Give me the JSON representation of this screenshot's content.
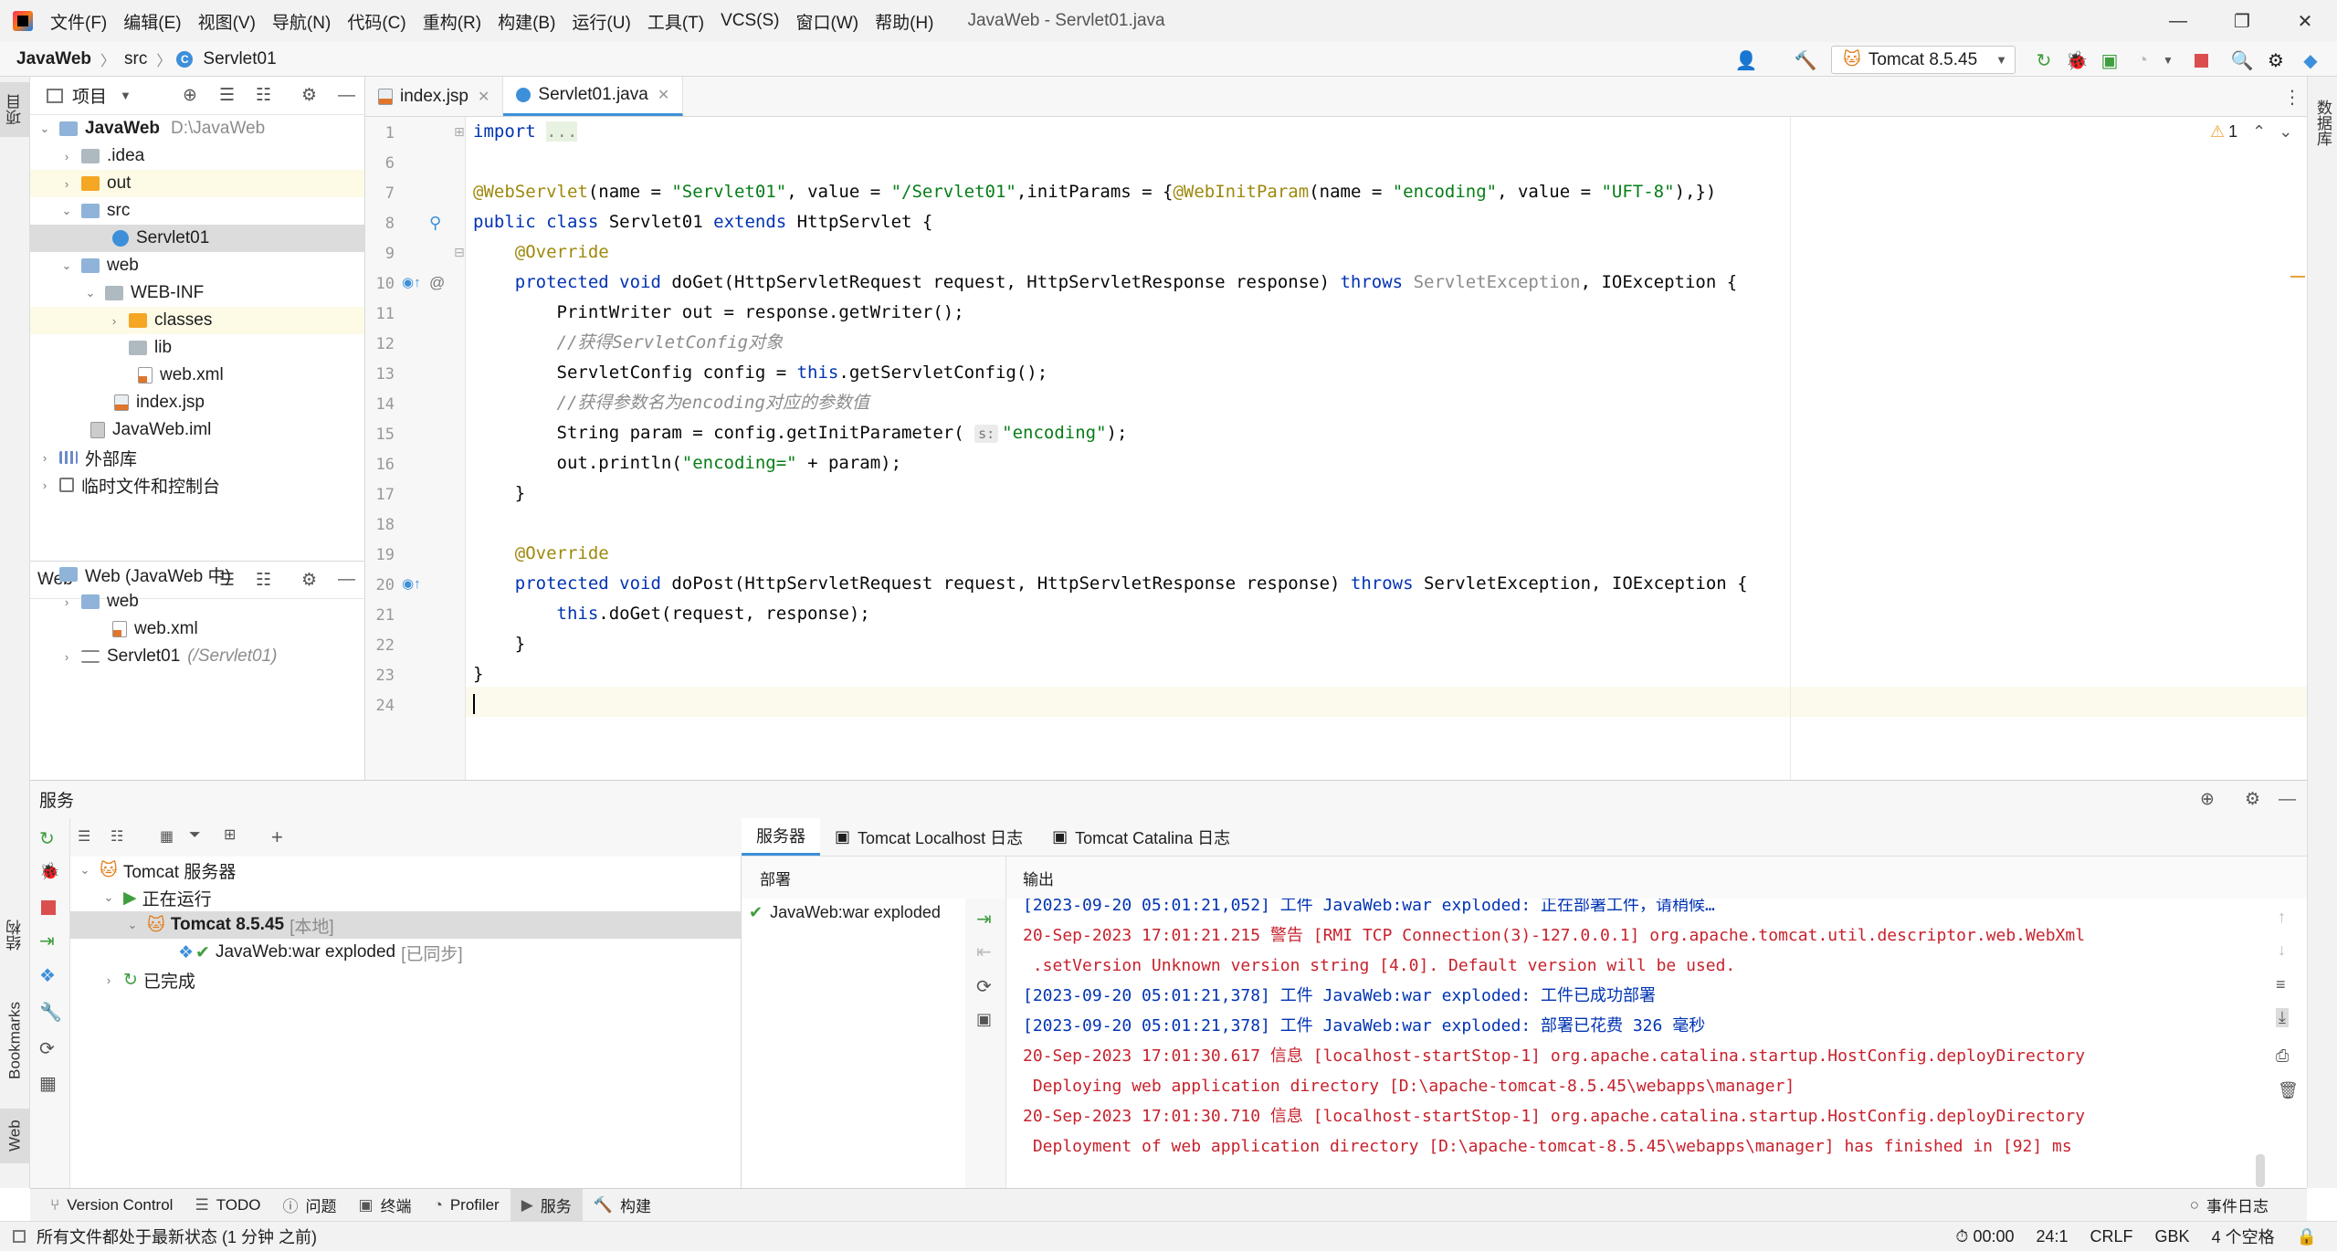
{
  "titlebar": {
    "menus": [
      "文件(F)",
      "编辑(E)",
      "视图(V)",
      "导航(N)",
      "代码(C)",
      "重构(R)",
      "构建(B)",
      "运行(U)",
      "工具(T)",
      "VCS(S)",
      "窗口(W)",
      "帮助(H)"
    ],
    "title": "JavaWeb - Servlet01.java"
  },
  "navbar": {
    "crumbs": [
      "JavaWeb",
      "src",
      "Servlet01"
    ],
    "run_config": "Tomcat 8.5.45"
  },
  "left_strip": {
    "project": "项目",
    "structure": "结构",
    "bookmarks": "Bookmarks",
    "web": "Web"
  },
  "right_strip": {
    "database": "数据库"
  },
  "project_panel": {
    "header": "项目",
    "tree": [
      {
        "label": "JavaWeb",
        "extra": "D:\\JavaWeb"
      },
      {
        "label": ".idea"
      },
      {
        "label": "out"
      },
      {
        "label": "src"
      },
      {
        "label": "Servlet01"
      },
      {
        "label": "web"
      },
      {
        "label": "WEB-INF"
      },
      {
        "label": "classes"
      },
      {
        "label": "lib"
      },
      {
        "label": "web.xml"
      },
      {
        "label": "index.jsp"
      },
      {
        "label": "JavaWeb.iml"
      },
      {
        "label": "外部库"
      },
      {
        "label": "临时文件和控制台"
      }
    ]
  },
  "web_panel": {
    "header": "Web",
    "tree": [
      {
        "label": "Web (JavaWeb 中)"
      },
      {
        "label": "web"
      },
      {
        "label": "web.xml"
      },
      {
        "label": "Servlet01",
        "extra": "(/Servlet01)"
      }
    ]
  },
  "editor": {
    "tabs": [
      "index.jsp",
      "Servlet01.java"
    ],
    "warning_count": "1",
    "line_numbers": [
      "1",
      "6",
      "7",
      "8",
      "9",
      "10",
      "11",
      "12",
      "13",
      "14",
      "15",
      "16",
      "17",
      "18",
      "19",
      "20",
      "21",
      "22",
      "23",
      "24"
    ],
    "hint_s": "s:"
  },
  "services": {
    "title": "服务",
    "tree": [
      {
        "label": "Tomcat 服务器"
      },
      {
        "label": "正在运行"
      },
      {
        "label": "Tomcat 8.5.45",
        "extra": "[本地]"
      },
      {
        "label": "JavaWeb:war exploded",
        "extra": "[已同步]"
      },
      {
        "label": "已完成"
      }
    ],
    "output_tabs": [
      "服务器",
      "Tomcat Localhost 日志",
      "Tomcat Catalina 日志"
    ],
    "deploy_header": "部署",
    "deploy_item": "JavaWeb:war exploded",
    "output_header": "输出",
    "log_lines": [
      "[2023-09-20 05:01:21,052] 工件 JavaWeb:war exploded: 正在部署工件，请稍候…",
      "20-Sep-2023 17:01:21.215 警告 [RMI TCP Connection(3)-127.0.0.1] org.apache.tomcat.util.descriptor.web.WebXml",
      " .setVersion Unknown version string [4.0]. Default version will be used.",
      "[2023-09-20 05:01:21,378] 工件 JavaWeb:war exploded: 工件已成功部署",
      "[2023-09-20 05:01:21,378] 工件 JavaWeb:war exploded: 部署已花费 326 毫秒",
      "20-Sep-2023 17:01:30.617 信息 [localhost-startStop-1] org.apache.catalina.startup.HostConfig.deployDirectory",
      " Deploying web application directory [D:\\apache-tomcat-8.5.45\\webapps\\manager]",
      "20-Sep-2023 17:01:30.710 信息 [localhost-startStop-1] org.apache.catalina.startup.HostConfig.deployDirectory",
      " Deployment of web application directory [D:\\apache-tomcat-8.5.45\\webapps\\manager] has finished in [92] ms"
    ]
  },
  "toolwindows": [
    "Version Control",
    "TODO",
    "问题",
    "终端",
    "Profiler",
    "服务",
    "构建"
  ],
  "event_log": "事件日志",
  "status": {
    "message": "所有文件都处于最新状态 (1 分钟 之前)",
    "timer": "00:00",
    "position": "24:1",
    "line_sep": "CRLF",
    "encoding": "GBK",
    "indent": "4 个空格"
  }
}
